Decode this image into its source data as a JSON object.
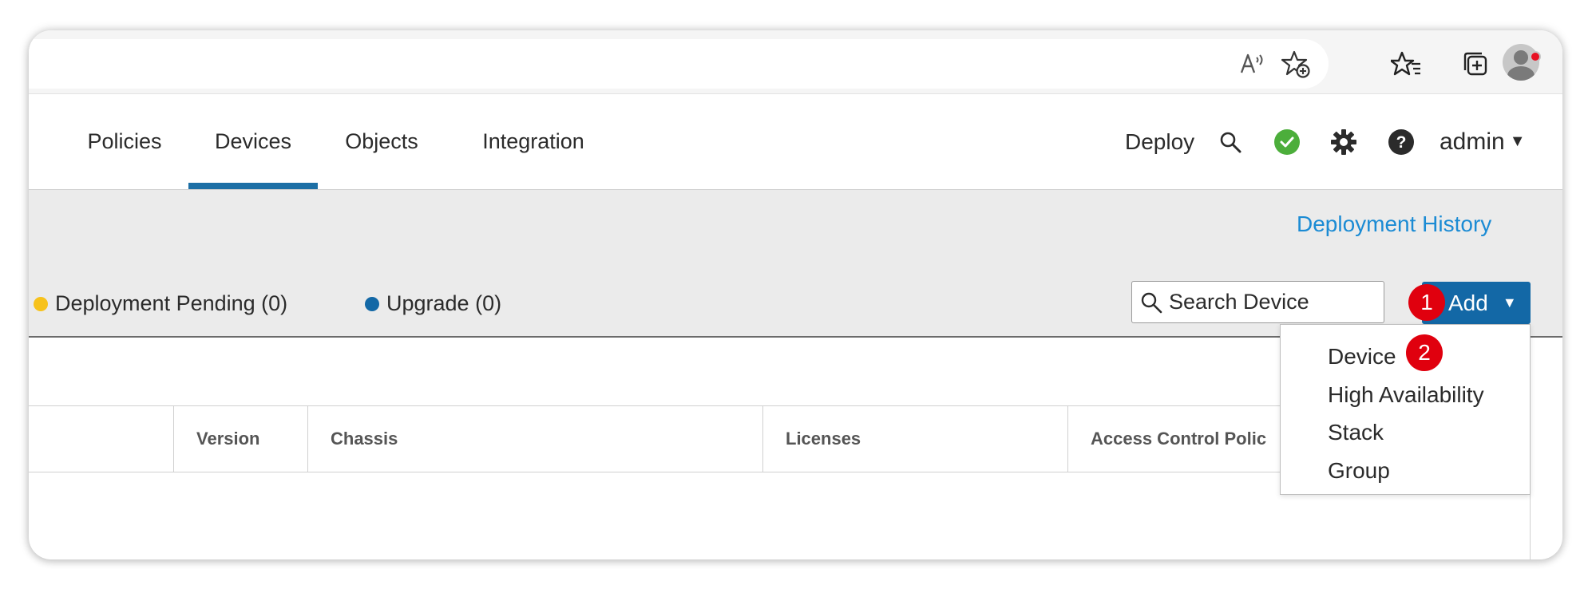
{
  "browser": {
    "icons": [
      "read-aloud-icon",
      "add-favorite-icon",
      "favorites-icon",
      "collections-icon",
      "profile-avatar"
    ]
  },
  "nav": {
    "tabs": [
      {
        "label": "Policies",
        "active": false
      },
      {
        "label": "Devices",
        "active": true
      },
      {
        "label": "Objects",
        "active": false
      },
      {
        "label": "Integration",
        "active": false
      }
    ],
    "deploy_label": "Deploy",
    "user_label": "admin",
    "status_color": "#4cae3b",
    "accent_color": "#1d6fa5"
  },
  "toolbar": {
    "deployment_history": "Deployment History",
    "legend": [
      {
        "label": "Deployment Pending (0)",
        "color": "#f7c21b"
      },
      {
        "label": "Upgrade (0)",
        "color": "#1368a6"
      }
    ],
    "search_placeholder": "Search Device",
    "add_label": "Add",
    "add_color": "#1368a6"
  },
  "table": {
    "columns": [
      "Version",
      "Chassis",
      "Licenses",
      "Access Control Polic"
    ]
  },
  "dropdown": {
    "items": [
      "Device",
      "High Availability",
      "Stack",
      "Group"
    ]
  },
  "badges": {
    "step1": "1",
    "step2": "2"
  }
}
